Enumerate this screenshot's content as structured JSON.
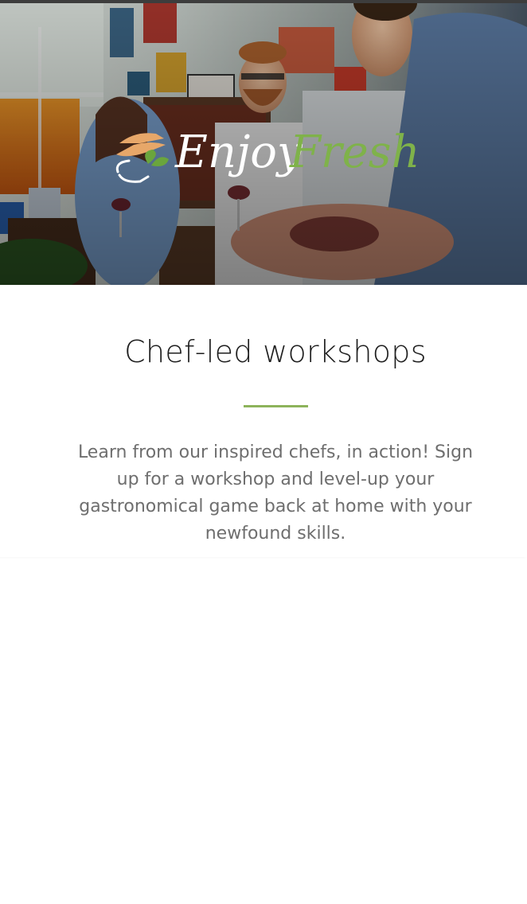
{
  "hero": {
    "logo": {
      "word_primary": "Enjoy",
      "word_accent": "Fresh",
      "accent_color": "#7fb24a",
      "mark_color": "#e7a769",
      "leaf_color": "#6aa53d"
    }
  },
  "section": {
    "title": "Chef-led workshops",
    "divider_color": "#8db35b",
    "description": "Learn from our inspired chefs, in action! Sign up for a workshop and level-up your gastronomical game back at home with your newfound skills."
  }
}
